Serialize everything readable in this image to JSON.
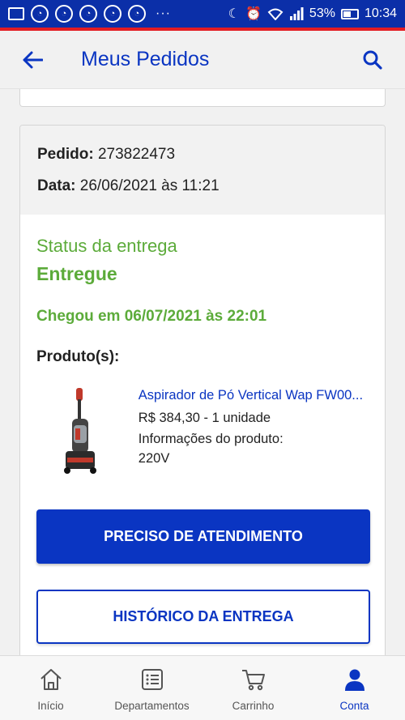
{
  "status_bar": {
    "battery": "53%",
    "time": "10:34",
    "dots": "···"
  },
  "header": {
    "title": "Meus Pedidos"
  },
  "order": {
    "order_label": "Pedido:",
    "order_number": "273822473",
    "date_label": "Data:",
    "date_value": "26/06/2021 às 11:21",
    "status_label": "Status da entrega",
    "status_value": "Entregue",
    "arrived": "Chegou em 06/07/2021 às 22:01",
    "products_title": "Produto(s):",
    "product": {
      "name": "Aspirador de Pó Vertical Wap FW00...",
      "price": "R$ 384,30 - 1 unidade",
      "info_label": "Informações do produto:",
      "voltage": "220V"
    },
    "primary_button": "PRECISO DE ATENDIMENTO",
    "secondary_button": "HISTÓRICO DA ENTREGA"
  },
  "bottom_nav": {
    "items": [
      {
        "label": "Início",
        "icon": "home-icon"
      },
      {
        "label": "Departamentos",
        "icon": "list-icon"
      },
      {
        "label": "Carrinho",
        "icon": "cart-icon"
      },
      {
        "label": "Conta",
        "icon": "user-icon"
      }
    ],
    "active": "Conta"
  },
  "colors": {
    "brand_blue": "#0a35c2",
    "status_green": "#5cab3a",
    "status_bar_blue": "#0b2fa8",
    "accent_red": "#e31c23"
  }
}
